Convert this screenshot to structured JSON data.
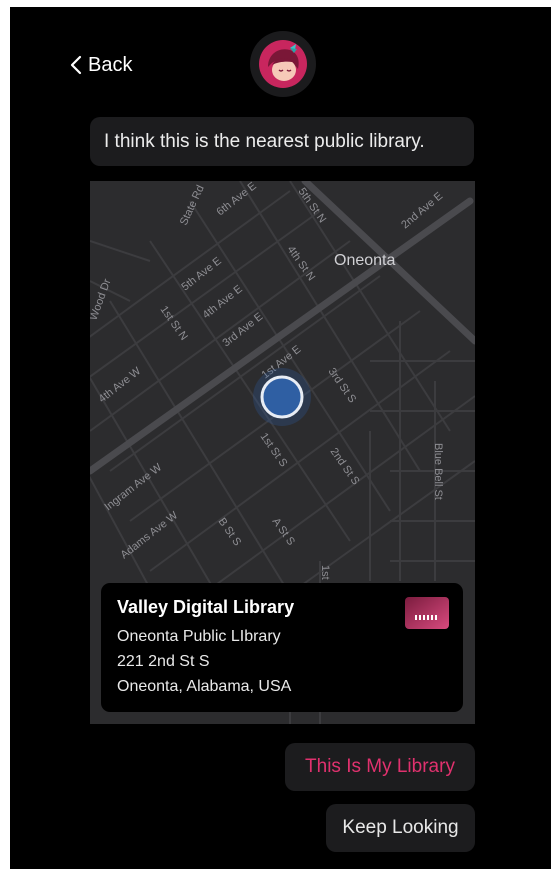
{
  "nav": {
    "back_label": "Back"
  },
  "message": {
    "text": "I think this is the nearest public library."
  },
  "map": {
    "labels": {
      "oneonta": "Oneonta",
      "state_rd": "State Rd",
      "sixth_ave_e": "6th Ave E",
      "fifth_st_n": "5th St N",
      "second_ave_e": "2nd Ave E",
      "fifth_ave_e": "5th Ave E",
      "fourth_st_n": "4th St N",
      "fourth_ave_e": "4th Ave E",
      "first_st_n": "1st St N",
      "third_ave_e": "3rd Ave E",
      "wood_dr": "Wood Dr",
      "fourth_ave_w": "4th Ave W",
      "first_ave_e": "1st Ave E",
      "third_st_s": "3rd St S",
      "first_st_s": "1st St S",
      "second_st_s": "2nd St S",
      "blue_bell_st": "Blue Bell St",
      "ingram_ave_w": "Ingram Ave W",
      "adams_ave_w": "Adams Ave W",
      "b_st_s": "B St S",
      "a_st_s": "A St S",
      "first_st_2": "1st"
    }
  },
  "library_card": {
    "name": "Valley Digital Library",
    "branch": "Oneonta Public LIbrary",
    "address": "221 2nd St S",
    "city": "Oneonta, Alabama, USA"
  },
  "actions": {
    "confirm_label": "This Is My Library",
    "keep_looking_label": "Keep Looking"
  },
  "colors": {
    "background": "#000000",
    "accent": "#e0316e",
    "bubble": "#1c1c1e",
    "map_bg": "#2c2c2e",
    "location_dot": "#2f5fa3"
  }
}
